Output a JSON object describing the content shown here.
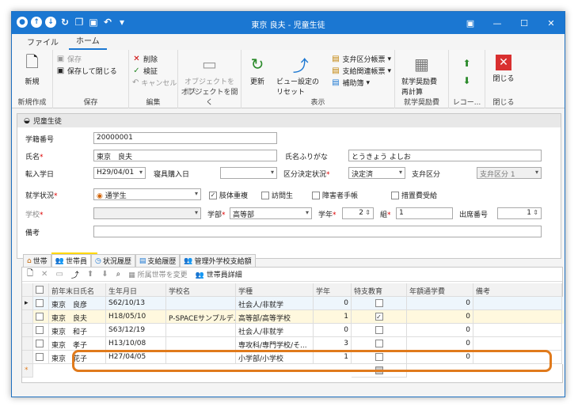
{
  "window": {
    "title": "東京 良夫 - 児童生徒"
  },
  "menu": {
    "tabs": [
      "ファイル",
      "ホーム"
    ]
  },
  "ribbon": {
    "new": {
      "label": "新規",
      "group": "新規作成"
    },
    "save": {
      "save": "保存",
      "save_close": "保存して閉じる",
      "group": "保存"
    },
    "edit": {
      "delete": "削除",
      "verify": "検証",
      "cancel": "キャンセル",
      "group": "編集"
    },
    "open_obj": {
      "label": "オブジェクトを開く",
      "group": "オブジェクトを開く"
    },
    "display": {
      "refresh": "更新",
      "reset_view": "ビュー設定のリセット",
      "pay_report": "支弁区分帳票",
      "pay_related": "支給関連帳票",
      "aux": "補助簿",
      "group": "表示"
    },
    "aid": {
      "label": "就学奨励費再計算",
      "group": "就学奨励費"
    },
    "record": {
      "group": "レコー..."
    },
    "close": {
      "label": "閉じる",
      "group": "閉じる"
    }
  },
  "panel": {
    "title": "児童生徒"
  },
  "form": {
    "gakuseki_label": "学籍番号",
    "gakuseki": "20000001",
    "name_label": "氏名",
    "name": "東京　良夫",
    "kana_label": "氏名ふりがな",
    "kana": "とうきょう よしお",
    "transfer_label": "転入学日",
    "transfer": "H29/04/01",
    "bedding_label": "寝具購入日",
    "bedding": "",
    "kubun_label": "区分決定状況",
    "kubun": "決定済",
    "payment_label": "支弁区分",
    "payment": "支弁区分 1",
    "status_label": "就学状況",
    "status": "通学生",
    "chk1": "肢体重複",
    "chk2": "訪問生",
    "chk3": "障害者手帳",
    "chk4": "措置費受給",
    "school_label": "学校",
    "school": "",
    "dept_label": "学部",
    "dept": "高等部",
    "grade_label": "学年",
    "grade": "2",
    "class_label": "組",
    "class": "1",
    "attend_label": "出席番号",
    "attend": "1",
    "note_label": "備考",
    "note": ""
  },
  "subtabs": [
    "世帯",
    "世帯員",
    "状況履歴",
    "支給履歴",
    "管理外学校支給額"
  ],
  "grid_toolbar": {
    "change": "所属世帯を変更",
    "detail": "世帯員詳細"
  },
  "grid": {
    "headers": [
      "前年末日氏名",
      "生年月日",
      "学校名",
      "学種",
      "学年",
      "特支教育",
      "年額通学費",
      "備考"
    ],
    "rows": [
      {
        "name": "東京　良彦",
        "birth": "S62/10/13",
        "school": "",
        "type": "社会人/非就学",
        "grade": "0",
        "special": false,
        "fee": "0",
        "note": ""
      },
      {
        "name": "東京　良夫",
        "birth": "H18/05/10",
        "school": "P-SPACEサンプルデ...",
        "type": "高等部/高等学校",
        "grade": "1",
        "special": true,
        "fee": "0",
        "note": ""
      },
      {
        "name": "東京　和子",
        "birth": "S63/12/19",
        "school": "",
        "type": "社会人/非就学",
        "grade": "0",
        "special": false,
        "fee": "0",
        "note": ""
      },
      {
        "name": "東京　孝子",
        "birth": "H13/10/08",
        "school": "",
        "type": "専攻科/専門学校/そ...",
        "grade": "3",
        "special": false,
        "fee": "0",
        "note": ""
      },
      {
        "name": "東京　花子",
        "birth": "H27/04/05",
        "school": "",
        "type": "小学部/小学校",
        "grade": "1",
        "special": false,
        "fee": "0",
        "note": ""
      }
    ]
  }
}
